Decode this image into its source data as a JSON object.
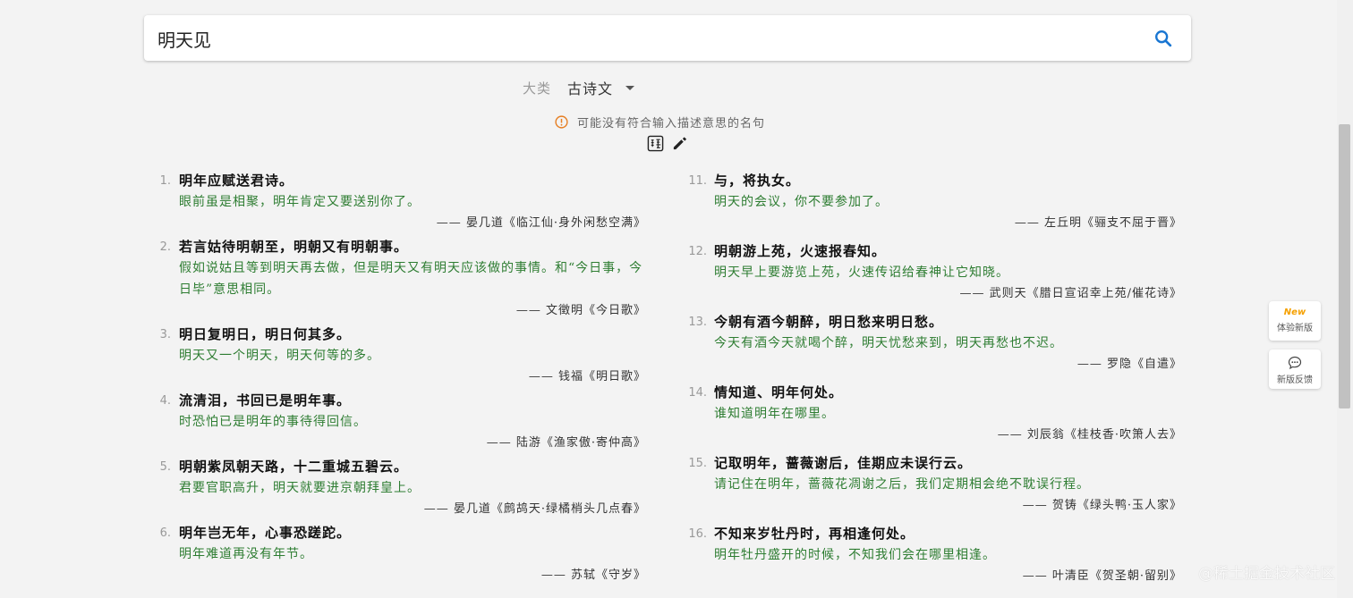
{
  "search": {
    "value": "明天见"
  },
  "category": {
    "label": "大类",
    "value": "古诗文"
  },
  "notice": {
    "text": "可能没有符合输入描述意思的名句"
  },
  "results_left": [
    {
      "index": "1.",
      "quote": "明年应赋送君诗。",
      "translation": "眼前虽是相聚，明年肯定又要送别你了。",
      "source": "—— 晏几道《临江仙·身外闲愁空满》"
    },
    {
      "index": "2.",
      "quote": "若言姑待明朝至，明朝又有明朝事。",
      "translation": "假如说姑且等到明天再去做，但是明天又有明天应该做的事情。和“今日事，今日毕”意思相同。",
      "source": "—— 文徵明《今日歌》"
    },
    {
      "index": "3.",
      "quote": "明日复明日，明日何其多。",
      "translation": "明天又一个明天，明天何等的多。",
      "source": "—— 钱福《明日歌》"
    },
    {
      "index": "4.",
      "quote": "流清泪，书回已是明年事。",
      "translation": "时恐怕已是明年的事待得回信。",
      "source": "—— 陆游《渔家傲·寄仲高》"
    },
    {
      "index": "5.",
      "quote": "明朝紫凤朝天路，十二重城五碧云。",
      "translation": "君要官职高升，明天就要进京朝拜皇上。",
      "source": "—— 晏几道《鹧鸪天·绿橘梢头几点春》"
    },
    {
      "index": "6.",
      "quote": "明年岂无年，心事恐蹉跎。",
      "translation": "明年难道再没有年节。",
      "source": "—— 苏轼《守岁》"
    }
  ],
  "results_right": [
    {
      "index": "11.",
      "quote": "与，将执女。",
      "translation": "明天的会议，你不要参加了。",
      "source": "—— 左丘明《骊支不屈于晋》"
    },
    {
      "index": "12.",
      "quote": "明朝游上苑，火速报春知。",
      "translation": "明天早上要游览上苑，火速传诏给春神让它知晓。",
      "source": "—— 武则天《腊日宣诏幸上苑/催花诗》"
    },
    {
      "index": "13.",
      "quote": "今朝有酒今朝醉，明日愁来明日愁。",
      "translation": "今天有酒今天就喝个醉，明天忧愁来到，明天再愁也不迟。",
      "source": "—— 罗隐《自遣》"
    },
    {
      "index": "14.",
      "quote": "情知道、明年何处。",
      "translation": "谁知道明年在哪里。",
      "source": "—— 刘辰翁《桂枝香·吹箫人去》"
    },
    {
      "index": "15.",
      "quote": "记取明年，蔷薇谢后，佳期应未误行云。",
      "translation": "请记住在明年，蔷薇花凋谢之后，我们定期相会绝不耽误行程。",
      "source": "—— 贺铸《绿头鸭·玉人家》"
    },
    {
      "index": "16.",
      "quote": "不知来岁牡丹时，再相逢何处。",
      "translation": "明年牡丹盛开的时候，不知我们会在哪里相逢。",
      "source": "—— 叶清臣《贺圣朝·留别》"
    }
  ],
  "float_buttons": {
    "new_badge": "New",
    "try_new": "体验新版",
    "feedback": "新版反馈"
  },
  "watermark": "@稀土掘金技术社区",
  "colors": {
    "translation": "#2e7d32",
    "search_icon": "#1976d2",
    "warning": "#e67e22",
    "new_badge": "#f5a000"
  },
  "icons": [
    "search-icon",
    "chevron-down-icon",
    "warning-icon",
    "translate-icon",
    "pencil-icon",
    "chat-icon"
  ]
}
